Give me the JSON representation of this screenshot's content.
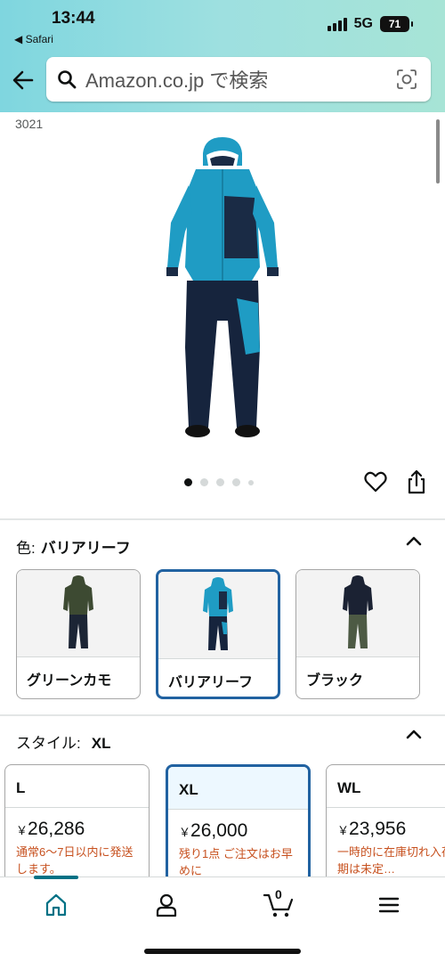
{
  "status_bar": {
    "time": "13:44",
    "back_app": "◀ Safari",
    "network": "5G",
    "battery": "71"
  },
  "search": {
    "placeholder": "Amazon.co.jp で検索"
  },
  "product": {
    "model_code": "3021"
  },
  "gallery": {
    "image_count": 5,
    "active_index": 0
  },
  "color_section": {
    "label": "色:",
    "selected": "バリアリーフ",
    "options": [
      {
        "name": "グリーンカモ"
      },
      {
        "name": "バリアリーフ"
      },
      {
        "name": "ブラック"
      }
    ]
  },
  "style_section": {
    "label": "スタイル:",
    "selected": "XL",
    "options": [
      {
        "size": "L",
        "price": "26,286",
        "currency": "￥",
        "availability": "通常6～7日以内に発送します。"
      },
      {
        "size": "XL",
        "price": "26,000",
        "currency": "￥",
        "availability": "残り1点 ご注文はお早めに"
      },
      {
        "size": "WL",
        "price": "23,956",
        "currency": "￥",
        "availability": "一時的に在庫切れ入荷時期は未定…"
      }
    ]
  },
  "bottom_nav": {
    "cart_count": "0"
  },
  "colors": {
    "accent": "#2162a1",
    "teal": "#007185",
    "warning": "#c7511f"
  }
}
